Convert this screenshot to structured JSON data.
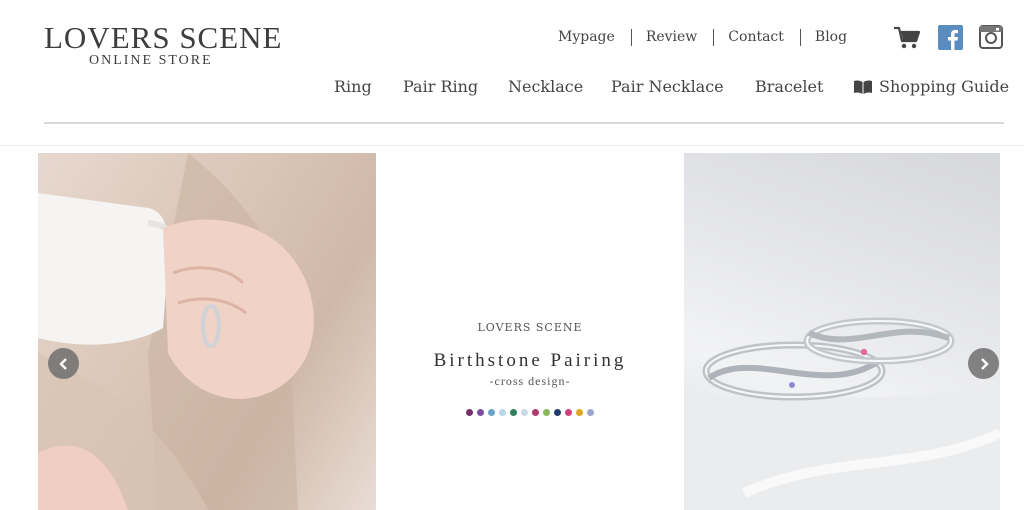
{
  "header": {
    "logo_main": "LOVERS SCENE",
    "logo_sub": "ONLINE STORE",
    "top_links": [
      "Mypage",
      "Review",
      "Contact",
      "Blog"
    ],
    "main_nav": [
      "Ring",
      "Pair Ring",
      "Necklace",
      "Pair Necklace",
      "Bracelet",
      "Shopping Guide"
    ],
    "icons": [
      "cart-icon",
      "facebook-icon",
      "instagram-icon",
      "book-icon"
    ]
  },
  "slider": {
    "brand": "LOVERS SCENE",
    "title": "Birthstone Pairing",
    "subtitle": "-cross design-",
    "gem_colors": [
      "#7b2d6d",
      "#7a4fa0",
      "#6aa3c9",
      "#b7d7e8",
      "#2f7f5a",
      "#c9d9e3",
      "#b03a6b",
      "#8ab65a",
      "#1f3b6e",
      "#d0407a",
      "#e0a526",
      "#9aa5c9"
    ],
    "arrows": [
      "chevron-left-icon",
      "chevron-right-icon"
    ]
  },
  "colors": {
    "text": "#444444",
    "divider": "#d9d9d9",
    "fb": "#5a8cbf"
  }
}
